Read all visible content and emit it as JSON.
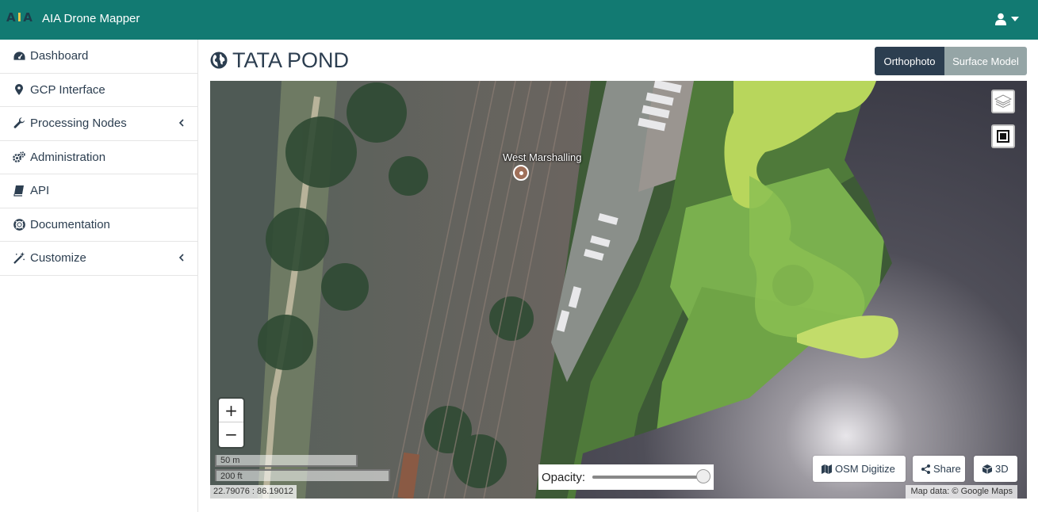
{
  "app": {
    "logo_text": "AIA",
    "title": "AIA Drone Mapper"
  },
  "header": {
    "user_icon": "user-icon",
    "caret_icon": "caret-down-icon"
  },
  "sidebar": {
    "items": [
      {
        "label": "Dashboard",
        "icon": "dashboard-icon"
      },
      {
        "label": "GCP Interface",
        "icon": "map-marker-icon"
      },
      {
        "label": "Processing Nodes",
        "icon": "wrench-icon",
        "expandable": true
      },
      {
        "label": "Administration",
        "icon": "gears-icon"
      },
      {
        "label": "API",
        "icon": "book-icon"
      },
      {
        "label": "Documentation",
        "icon": "life-ring-icon"
      },
      {
        "label": "Customize",
        "icon": "magic-wand-icon",
        "expandable": true
      }
    ]
  },
  "page": {
    "title": "TATA POND",
    "title_icon": "globe-icon"
  },
  "view_toggle": {
    "orthophoto_label": "Orthophoto",
    "surface_model_label": "Surface Model",
    "active": "Orthophoto"
  },
  "map": {
    "poi_label": "West Marshalling",
    "zoom_in_label": "+",
    "zoom_out_label": "−",
    "scale_metric": "50 m",
    "scale_imperial": "200 ft",
    "coordinates": "22.79076 : 86.19012",
    "opacity_label": "Opacity:",
    "opacity_value": 1.0,
    "osm_button_label": "OSM Digitize",
    "share_button_label": "Share",
    "three_d_button_label": "3D",
    "attribution": "Map data: © Google Maps",
    "layers_icon": "layers-icon",
    "fullscreen_icon": "fullscreen-icon"
  }
}
